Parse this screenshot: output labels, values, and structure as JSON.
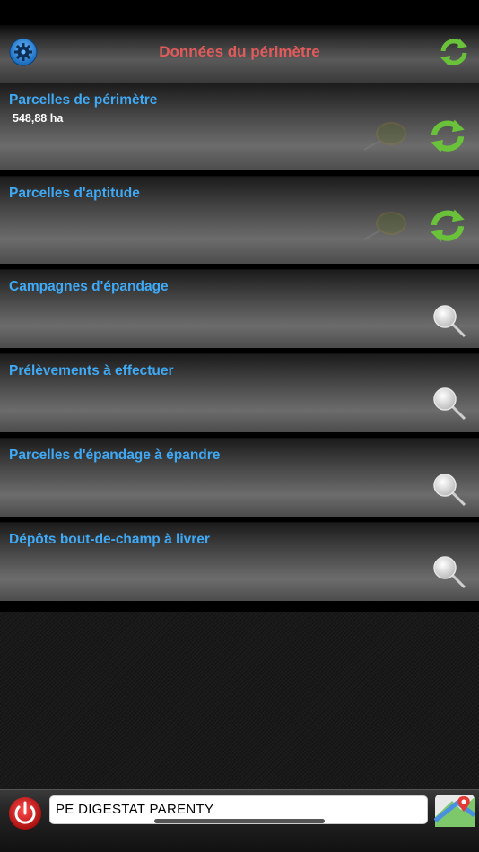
{
  "header": {
    "title": "Données du périmètre",
    "settings_icon": "gear-icon",
    "refresh_icon": "sync-icon"
  },
  "cards": [
    {
      "label": "Parcelles de périmètre",
      "value": "548,88 ha",
      "action": "sync"
    },
    {
      "label": "Parcelles d'aptitude",
      "value": "",
      "action": "sync"
    },
    {
      "label": "Campagnes d'épandage",
      "value": "",
      "action": "search"
    },
    {
      "label": "Prélèvements à effectuer",
      "value": "",
      "action": "search"
    },
    {
      "label": "Parcelles d'épandage à épandre",
      "value": "",
      "action": "search"
    },
    {
      "label": "Dépôts bout-de-champ à livrer",
      "value": "",
      "action": "search"
    }
  ],
  "footer": {
    "site_field_value": "PE DIGESTAT PARENTY",
    "power_icon": "power-icon",
    "maps_icon": "maps-icon"
  },
  "colors": {
    "accent_blue": "#3fa9f5",
    "title_red": "#e25b5b",
    "sync_green": "#6ac23a",
    "power_red": "#e02020"
  }
}
